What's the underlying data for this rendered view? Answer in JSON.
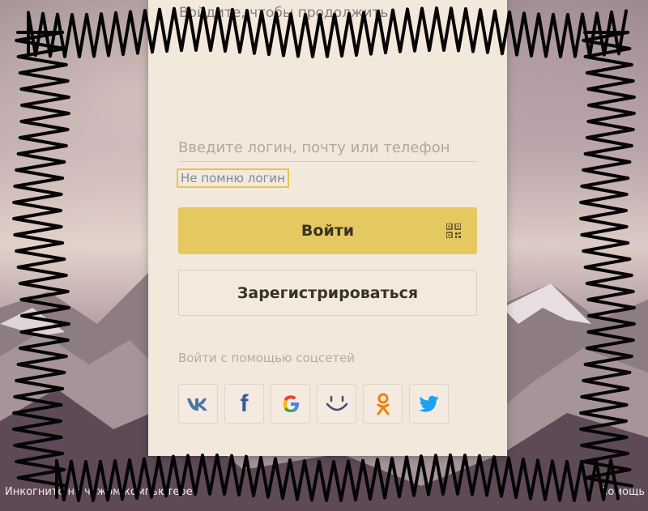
{
  "panel": {
    "subtitle": "Войдите, чтобы продолжить",
    "login_placeholder": "Введите логин, почту или телефон",
    "forgot_login": "Не помню логин",
    "login_button": "Войти",
    "register_button": "Зарегистрироваться",
    "social_label": "Войти с помощью соцсетей",
    "social": [
      {
        "name": "vk",
        "icon": "vk-icon"
      },
      {
        "name": "facebook",
        "icon": "facebook-icon"
      },
      {
        "name": "google",
        "icon": "google-icon"
      },
      {
        "name": "mail.ru",
        "icon": "mailru-icon"
      },
      {
        "name": "odnoklassniki",
        "icon": "ok-icon"
      },
      {
        "name": "twitter",
        "icon": "twitter-icon"
      }
    ]
  },
  "footer": {
    "incognito": "Инкогнито на чужом компьютере",
    "help": "Помощь"
  },
  "colors": {
    "accent": "#e6c860",
    "vk": "#4a76a8",
    "facebook": "#3b5998",
    "ok": "#ee8208",
    "twitter": "#1da1f2"
  }
}
